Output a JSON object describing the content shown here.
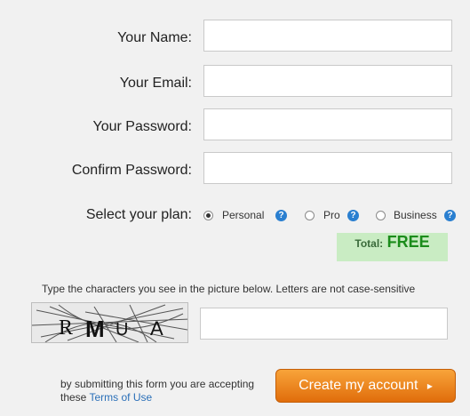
{
  "form": {
    "name_label": "Your Name:",
    "email_label": "Your Email:",
    "password_label": "Your Password:",
    "confirm_label": "Confirm Password:",
    "name_value": "",
    "email_value": "",
    "password_value": "",
    "confirm_value": ""
  },
  "plan": {
    "label": "Select your plan:",
    "options": [
      {
        "label": "Personal",
        "selected": true
      },
      {
        "label": "Pro",
        "selected": false
      },
      {
        "label": "Business",
        "selected": false
      }
    ],
    "help_icon": "help-icon",
    "help_glyph": "?"
  },
  "total": {
    "label": "Total:",
    "value": "FREE"
  },
  "captcha": {
    "instruction": "Type the characters you see in the picture below. Letters are not case-sensitive",
    "image_text": "RMUA",
    "value": ""
  },
  "footer": {
    "text_prefix": "by submitting this form you are accepting these",
    "terms_link": "Terms of Use"
  },
  "submit": {
    "label": "Create my account",
    "arrow": "▸"
  },
  "colors": {
    "background": "#f1f1f1",
    "total_box": "#c9ecc3",
    "total_value": "#1b8c1b",
    "button": "#f08a1c",
    "link": "#2a6fb8",
    "help_icon": "#2a7fd0"
  }
}
